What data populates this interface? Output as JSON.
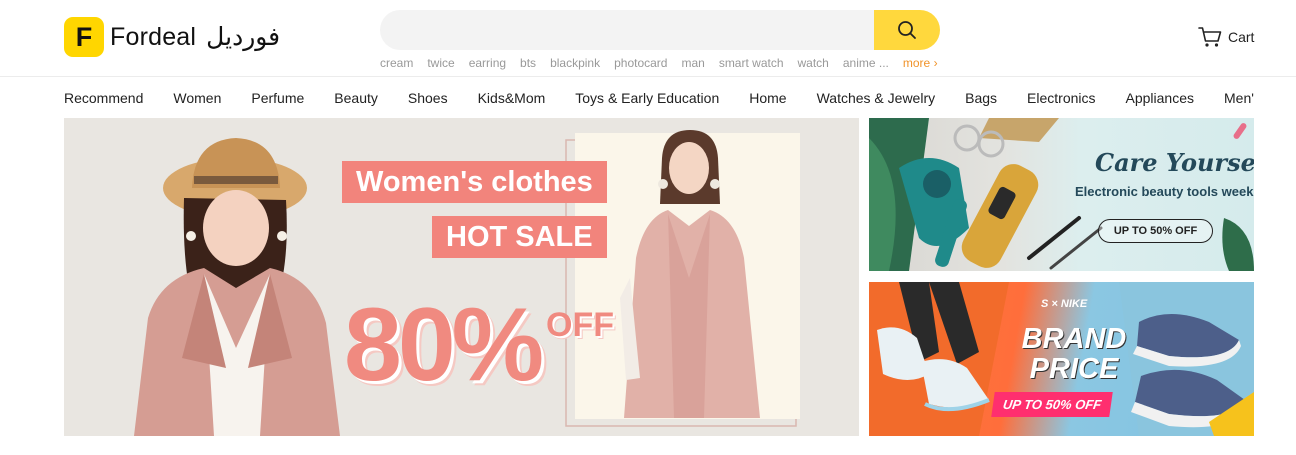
{
  "brand": {
    "logo_letter": "F",
    "name": "Fordeal",
    "name_arabic": "فورديل"
  },
  "search": {
    "placeholder": ""
  },
  "hot_words": [
    "cream",
    "twice",
    "earring",
    "bts",
    "blackpink",
    "photocard",
    "man",
    "smart watch",
    "watch",
    "anime ..."
  ],
  "hot_more": "more ›",
  "cart": {
    "label": "Cart"
  },
  "nav": [
    "Recommend",
    "Women",
    "Perfume",
    "Beauty",
    "Shoes",
    "Kids&Mom",
    "Toys & Early Education",
    "Home",
    "Watches & Jewelry",
    "Bags",
    "Electronics",
    "Appliances",
    "Men'"
  ],
  "hero": {
    "line1": "Women's clothes",
    "line2": "HOT SALE",
    "percent": "80%",
    "off": "OFF"
  },
  "side1": {
    "title": "Care Yourself",
    "subtitle": "Electronic beauty tools week",
    "button": "UP TO 50% OFF"
  },
  "side2": {
    "brands": "S × NIKE",
    "title": "BRAND PRICE",
    "promo": "UP TO 50% OFF"
  },
  "colors": {
    "accent": "#ffd83d",
    "hero_pink": "#f2847c",
    "more_link": "#f0932a"
  }
}
